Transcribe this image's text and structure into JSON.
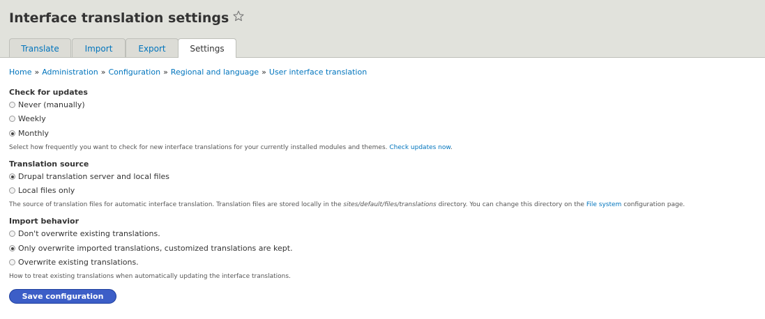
{
  "page": {
    "title": "Interface translation settings",
    "favorite_icon": "star-outline-icon"
  },
  "tabs": [
    {
      "label": "Translate",
      "active": false
    },
    {
      "label": "Import",
      "active": false
    },
    {
      "label": "Export",
      "active": false
    },
    {
      "label": "Settings",
      "active": true
    }
  ],
  "breadcrumb": {
    "items": [
      "Home",
      "Administration",
      "Configuration",
      "Regional and language",
      "User interface translation"
    ],
    "separator": "»"
  },
  "check_updates": {
    "title": "Check for updates",
    "options": [
      {
        "label": "Never (manually)",
        "checked": false
      },
      {
        "label": "Weekly",
        "checked": false
      },
      {
        "label": "Monthly",
        "checked": true
      }
    ],
    "description": "Select how frequently you want to check for new interface translations for your currently installed modules and themes.",
    "link": "Check updates now",
    "link_after": "."
  },
  "translation_source": {
    "title": "Translation source",
    "options": [
      {
        "label": "Drupal translation server and local files",
        "checked": true
      },
      {
        "label": "Local files only",
        "checked": false
      }
    ],
    "description_before": "The source of translation files for automatic interface translation. Translation files are stored locally in the",
    "path": "sites/default/files/translations",
    "description_middle": "directory. You can change this directory on the",
    "link": "File system",
    "description_after": "configuration page."
  },
  "import_behavior": {
    "title": "Import behavior",
    "options": [
      {
        "label": "Don't overwrite existing translations.",
        "checked": false
      },
      {
        "label": "Only overwrite imported translations, customized translations are kept.",
        "checked": true
      },
      {
        "label": "Overwrite existing translations.",
        "checked": false
      }
    ],
    "description": "How to treat existing translations when automatically updating the interface translations."
  },
  "actions": {
    "save_label": "Save configuration"
  },
  "colors": {
    "link": "#0074bd",
    "header_bg": "#e1e2dc",
    "primary_button": "#3c5ec7"
  }
}
